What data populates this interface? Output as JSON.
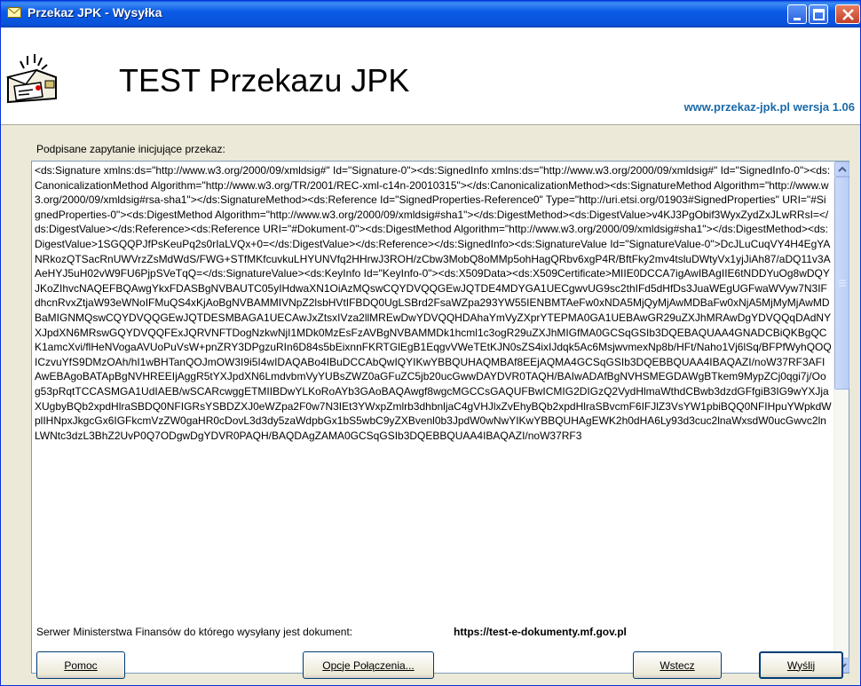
{
  "window": {
    "title": "Przekaz JPK - Wysyłka",
    "title_icon": "envelope-icon"
  },
  "header": {
    "title": "TEST Przekazu JPK",
    "version": "www.przekaz-jpk.pl wersja 1.06",
    "logo_icon": "mailbox-logo-icon"
  },
  "main": {
    "request_label": "Podpisane zapytanie inicjujące przekaz:",
    "request_text": "<ds:Signature xmlns:ds=\"http://www.w3.org/2000/09/xmldsig#\" Id=\"Signature-0\"><ds:SignedInfo xmlns:ds=\"http://www.w3.org/2000/09/xmldsig#\" Id=\"SignedInfo-0\"><ds:CanonicalizationMethod Algorithm=\"http://www.w3.org/TR/2001/REC-xml-c14n-20010315\"></ds:CanonicalizationMethod><ds:SignatureMethod Algorithm=\"http://www.w3.org/2000/09/xmldsig#rsa-sha1\"></ds:SignatureMethod><ds:Reference Id=\"SignedProperties-Reference0\" Type=\"http://uri.etsi.org/01903#SignedProperties\" URI=\"#SignedProperties-0\"><ds:DigestMethod Algorithm=\"http://www.w3.org/2000/09/xmldsig#sha1\"></ds:DigestMethod><ds:DigestValue>v4KJ3PgObif3WyxZydZxJLwRRsI=</ds:DigestValue></ds:Reference><ds:Reference URI=\"#Dokument-0\"><ds:DigestMethod Algorithm=\"http://www.w3.org/2000/09/xmldsig#sha1\"></ds:DigestMethod><ds:DigestValue>1SGQQPJfPsKeuPq2s0rIaLVQx+0=</ds:DigestValue></ds:Reference></ds:SignedInfo><ds:SignatureValue Id=\"SignatureValue-0\">DcJLuCuqVY4H4EgYANRkozQTSacRnUWVrzZsMdWdS/FWG+STfMKfcuvkuLHYUNVfq2HHrwJ3ROH/zCbw3MobQ8oMMp5ohHagQRbv6xgP4R/BftFky2mv4tsluDWtyVx1yjJiAh87/aDQ11v3AAeHYJ5uH02vW9FU6PjpSVeTqQ=</ds:SignatureValue><ds:KeyInfo Id=\"KeyInfo-0\"><ds:X509Data><ds:X509Certificate>MIIE0DCCA7igAwIBAgIIE6tNDDYuOg8wDQYJKoZIhvcNAQEFBQAwgYkxFDASBgNVBAUTC05yIHdwaXN1OiAzMQswCQYDVQQGEwJQTDE4MDYGA1UECgwvUG9sc2thIFd5dHfDs3JuaWEgUGFwaWVyw7N3IFdhcnRvxZtjaW93eWNoIFMuQS4xKjAoBgNVBAMMIVNpZ2lsbHVtIFBDQ0UgLSBrd2FsaWZpa293YW55IENBMTAeFw0xNDA5MjQyMjAwMDBaFw0xNjA5MjMyMjAwMDBaMIGNMQswCQYDVQQGEwJQTDESMBAGA1UECAwJxZtsxIVza2llMREwDwYDVQQHDAhaYmVyZXprYTEPMA0GA1UEBAwGR29uZXJhMRAwDgYDVQQqDAdNYXJpdXN6MRswGQYDVQQFExJQRVNFTDogNzkwNjI1MDk0MzEsFzAVBgNVBAMMDk1hcml1c3ogR29uZXJhMIGfMA0GCSqGSIb3DQEBAQUAA4GNADCBiQKBgQCK1amcXvi/flHeNVogaAVUoPuVsW+pnZRY3DPgzuRIn6D84s5bEixnnFKRTGlEgB1EqgvVWeTEtKJN0sZS4ixIJdqk5Ac6MsjwvmexNp8b/HFt/Naho1Vj6lSq/BFPfWyhQOQICzvuYfS9DMzOAh/hI1wBHTanQOJmOW3I9i5I4wIDAQABo4IBuDCCAbQwIQYIKwYBBQUHAQMBAf8EEjAQMA4GCSqGSIb3DQEBBQUAA4IBAQAZI/noW37RF3AFIAwEBAgoBATApBgNVHREEIjAggR5tYXJpdXN6LmdvbmVyYUBsZWZ0aGFuZC5jb20ucGwwDAYDVR0TAQH/BAIwADAfBgNVHSMEGDAWgBTkem9MypZCj0qgi7j/Oog53pRqtTCCASMGA1UdIAEB/wSCARcwggETMIIBDwYLKoRoAYb3GAoBAQAwgf8wgcMGCCsGAQUFBwICMIG2DIGzQ2VydHlmaWthdCBwb3dzdGFfgiB3IG9wYXJjaXUgbyBQb2xpdHlraSBDQ0NFIGRsYSBDZXJ0eWZpa2F0w7N3IEt3YWxpZmlrb3dhbnljaC4gVHJlxZvEhyBQb2xpdHlraSBvcmF6IFJlZ3VsYW1pbiBQQ0NFIHpuYWpkdWplIHNpxJkgcGx6IGFkcmVzZW0gaHR0cDovL3d3dy5zaWdpbGx1bS5wbC9yZXBvenl0b3JpdW0wNwYIKwYBBQUHAgEWK2h0dHA6Ly93d3cuc2lnaWxsdW0ucGwvc2lnLWNtc3dzL3BhZ2UvP0Q7ODgwDgYDVR0PAQH/BAQDAgZAMA0GCSqGSIb3DQEBBQUAA4IBAQAZI/noW37RF3",
    "server_label": "Serwer Ministerstwa Finansów do którego wysyłany jest dokument:",
    "server_url": "https://test-e-dokumenty.mf.gov.pl"
  },
  "buttons": {
    "help": "Pomoc",
    "connection_options": "Opcje Połączenia...",
    "back": "Wstecz",
    "send": "Wyślij"
  },
  "colors": {
    "titlebar": "#0b5be6",
    "window_bg": "#ece9d8",
    "version_text": "#1a6aa8"
  }
}
